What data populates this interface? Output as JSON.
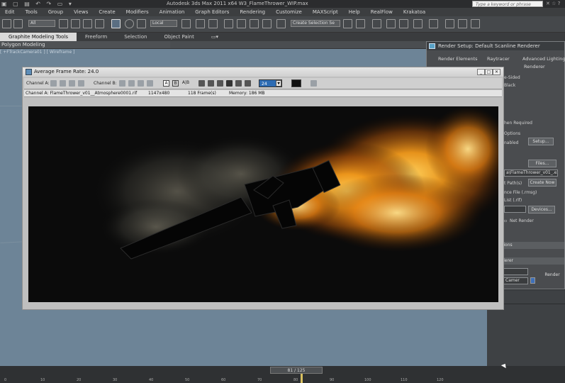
{
  "app": {
    "title": "Autodesk 3ds Max  2011 x64      W3_FlameThrower_WIP.max",
    "search_placeholder": "Type a keyword or phrase"
  },
  "menu": [
    "Edit",
    "Tools",
    "Group",
    "Views",
    "Create",
    "Modifiers",
    "Animation",
    "Graph Editors",
    "Rendering",
    "Customize",
    "MAXScript",
    "Help",
    "RealFlow",
    "Krakatoa"
  ],
  "toolbar": {
    "selection_filter": "All",
    "ref_coord": "Local",
    "named_selection": "Create Selection Se"
  },
  "ribbon": {
    "tabs": [
      "Graphite Modeling Tools",
      "Freeform",
      "Selection",
      "Object Paint"
    ],
    "sub_label": "Polygon Modeling"
  },
  "viewport": {
    "label": "[ +FTrackCamera01 ] [ Wireframe ]"
  },
  "render_setup": {
    "title": "Render Setup: Default Scanline Renderer",
    "tabs": [
      "Render Elements",
      "Raytracer",
      "Advanced Lighting",
      "Renderer"
    ],
    "texts": [
      "e-Sided",
      "Black",
      "hen Required",
      "Options",
      "nabled",
      "t Path(s)",
      "nce File (.rmsg)",
      "List (.rlf)",
      "Net Render"
    ],
    "setup_button": "Setup...",
    "files_button": "Files...",
    "path_value": "a\\FlameThrower_v01_.exr",
    "create_now_button": "Create Now",
    "devices_button": "Devices...",
    "header_options": "tions",
    "header_renderer": "derer",
    "render_button": "Render",
    "view_value": "Camer"
  },
  "framebuffer": {
    "title": "Average Frame Rate: 24.0",
    "channel_a": "Channel A:",
    "channel_b": "Channel B:",
    "frame_value": "24",
    "info": {
      "channel": "Channel A: FlameThrower_v01__Atmosphere0001.rif",
      "resolution": "1147x480",
      "frames": "118 Frame(s)",
      "memory": "Memory: 186 MB"
    },
    "btn_a": "A",
    "btn_b": "B",
    "btn_ab": "A|B"
  },
  "timeline": {
    "slider": "81 / 125",
    "ticks": [
      "0",
      "10",
      "20",
      "30",
      "40",
      "50",
      "60",
      "70",
      "80",
      "90",
      "100",
      "110",
      "120"
    ]
  }
}
